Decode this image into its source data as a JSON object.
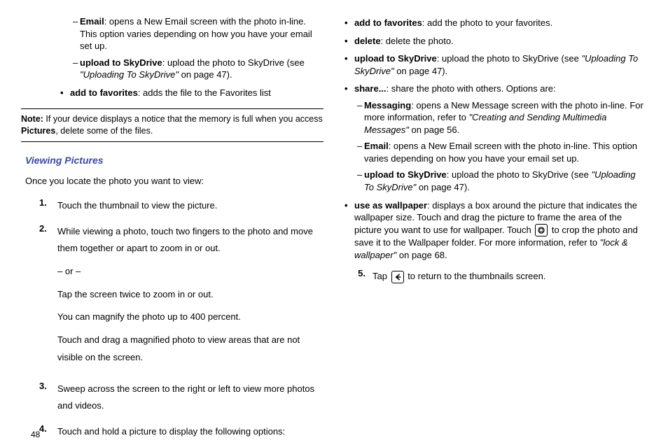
{
  "pageNumber": "48",
  "left": {
    "dash_email_bold": "Email",
    "dash_email_rest": ": opens a New Email screen with the photo in-line. This option varies depending on how you have your email set up.",
    "dash_upload_bold": "upload to SkyDrive",
    "dash_upload_rest_pre": ": upload the photo to SkyDrive (see ",
    "dash_upload_ref": "\"Uploading To SkyDrive\"",
    "dash_upload_rest_post": " on page 47).",
    "dot_addfav_bold": "add to favorites",
    "dot_addfav_rest": ": adds the file to the Favorites list",
    "note_label": "Note:",
    "note_text_pre": " If your device displays a notice that the memory is full when you access ",
    "note_bold": "Pictures",
    "note_text_post": ", delete some of the files.",
    "heading": "Viewing Pictures",
    "intro": "Once you locate the photo you want to view:",
    "s1_num": "1.",
    "s1_text": "Touch the thumbnail to view the picture.",
    "s2_num": "2.",
    "s2_text": "While viewing a photo, touch two fingers to the photo and move them together or apart to zoom in or out.",
    "s2_or": "– or –",
    "s2_tap": "Tap the screen twice to zoom in or out.",
    "s2_mag": "You can magnify the photo up to 400 percent.",
    "s2_drag": "Touch and drag a magnified photo to view areas that are not visible on the screen.",
    "s3_num": "3.",
    "s3_text": "Sweep across the screen to the right or left to view more photos and videos.",
    "s4_num": "4.",
    "s4_text": "Touch and hold a picture to display the following options:"
  },
  "right": {
    "addfav_bold": "add to favorites",
    "addfav_rest": ": add the photo to your favorites.",
    "delete_bold": "delete",
    "delete_rest": ": delete the photo.",
    "upload_bold": "upload to SkyDrive",
    "upload_rest_pre": ": upload the photo to SkyDrive (see ",
    "upload_ref": "\"Uploading To SkyDrive\"",
    "upload_rest_post": " on page 47).",
    "share_bold": "share...",
    "share_rest": ": share the photo with others. Options are:",
    "msg_bold": "Messaging",
    "msg_rest_pre": ": opens a New Message screen with the photo in-line. For more information, refer to ",
    "msg_ref": "\"Creating and Sending Multimedia Messages\"",
    "msg_rest_post": "  on page 56.",
    "email_bold": "Email",
    "email_rest": ": opens a New Email screen with the photo in-line. This option varies depending on how you have your email set up.",
    "upload2_bold": "upload to SkyDrive",
    "upload2_rest_pre": ": upload the photo to SkyDrive (see ",
    "upload2_ref": "\"Uploading To SkyDrive\"",
    "upload2_rest_post": " on page 47).",
    "wall_bold": "use as wallpaper",
    "wall_rest_pre": ": displays a box around the picture that indicates the wallpaper size. Touch and drag the picture to frame the area of the picture you want to use for wallpaper. Touch ",
    "wall_rest_mid": " to crop the photo and save it to the Wallpaper folder. For more information, refer to ",
    "wall_ref": "\"lock & wallpaper\"",
    "wall_rest_post": "  on page 68.",
    "s5_num": "5.",
    "s5_pre": "Tap ",
    "s5_post": " to return to the thumbnails screen."
  }
}
